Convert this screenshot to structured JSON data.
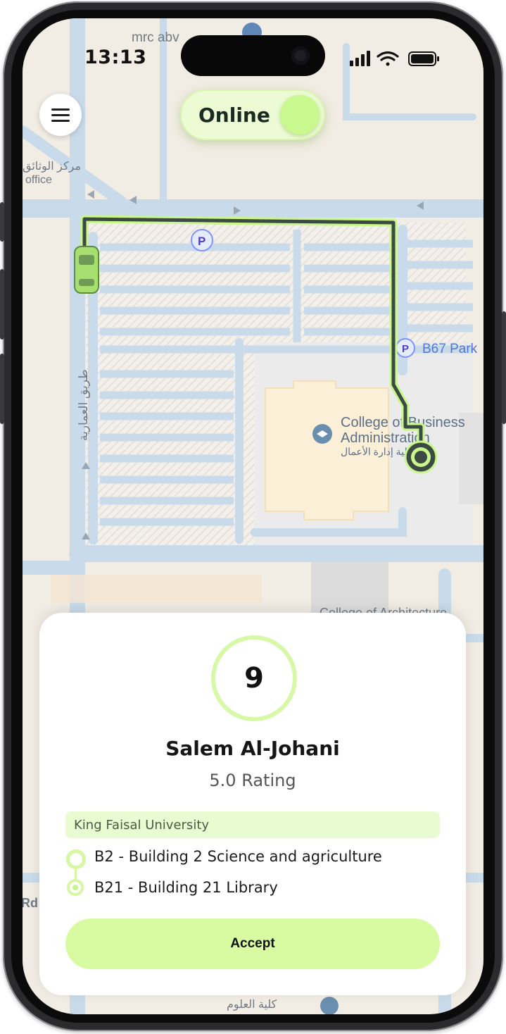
{
  "status_bar": {
    "time": "13:13"
  },
  "header": {
    "status_toggle_label": "Online",
    "status_toggle_on": true
  },
  "map": {
    "labels": {
      "top_place": "mrc abv",
      "office_ar": "مركز الوثائق",
      "office": "office",
      "road_ar": "طريق العمارية",
      "parking": "B67 Park",
      "college_line1": "College of Business",
      "college_line2": "Administration",
      "college_ar": "كلية إدارة الأعمال",
      "architecture": "College of Architecture",
      "bottom_ar": "كلية العلوم",
      "parking_icon_letter": "P",
      "left_fragment": "Rd"
    }
  },
  "request_card": {
    "countdown": "9",
    "rider_name": "Salem Al-Johani",
    "rating": "5.0 Rating",
    "university": "King Faisal University",
    "pickup": "B2 - Building 2 Science and agriculture",
    "dropoff": "B21 - Building 21 Library",
    "accept_label": "Accept"
  },
  "colors": {
    "accent": "#d8fba2",
    "route": "#3d4a44",
    "route_glow": "#c8f88c",
    "map_background": "#f1ece4",
    "map_road": "#c9dbea"
  }
}
